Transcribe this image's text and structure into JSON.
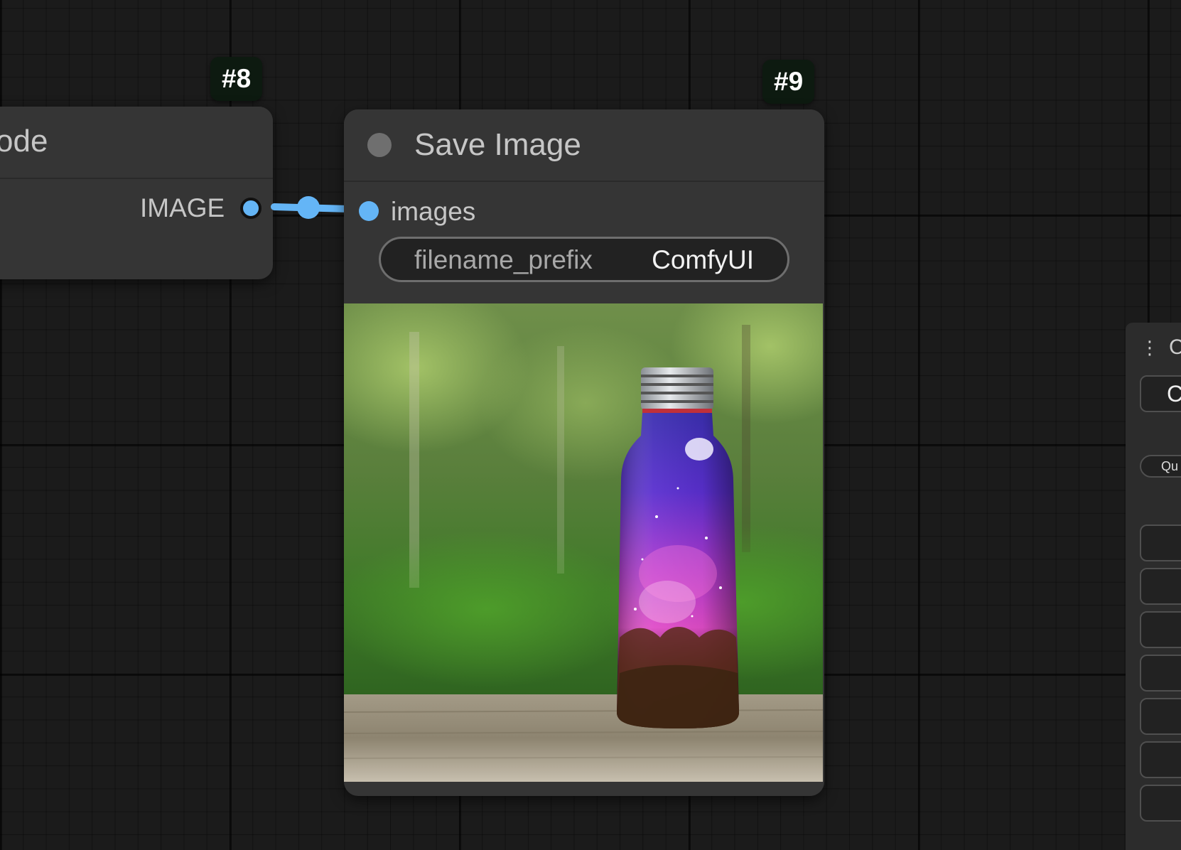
{
  "canvas": {
    "background": "#1b1b1b",
    "link_color": "#64b5f6"
  },
  "node8": {
    "badge": "#8",
    "title_partial": "ode",
    "output_label": "IMAGE"
  },
  "node9": {
    "badge": "#9",
    "title": "Save Image",
    "input_label": "images",
    "widget": {
      "name": "filename_prefix",
      "value": "ComfyUI"
    },
    "preview": {
      "subject": "glass bottle with galaxy nebula inside on wooden table, forest background"
    }
  },
  "side_panel": {
    "menu_icon": "vertical-dots-icon",
    "partial_title": "C",
    "partial_button": "C",
    "queue_label_partial": "Qu"
  }
}
